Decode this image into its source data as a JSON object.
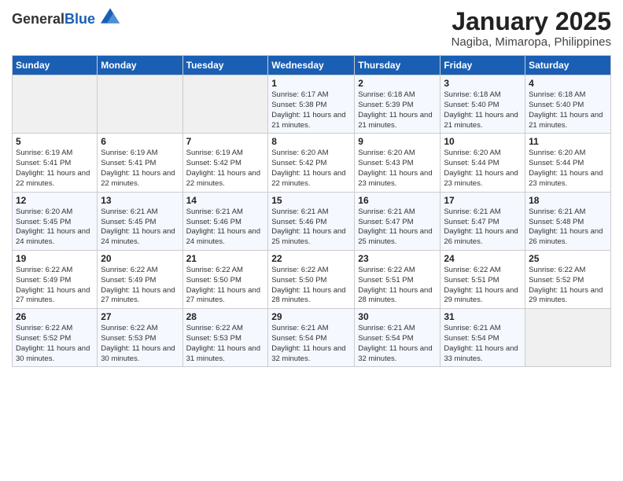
{
  "header": {
    "logo_general": "General",
    "logo_blue": "Blue",
    "title": "January 2025",
    "subtitle": "Nagiba, Mimaropa, Philippines"
  },
  "weekdays": [
    "Sunday",
    "Monday",
    "Tuesday",
    "Wednesday",
    "Thursday",
    "Friday",
    "Saturday"
  ],
  "weeks": [
    [
      {
        "day": "",
        "empty": true
      },
      {
        "day": "",
        "empty": true
      },
      {
        "day": "",
        "empty": true
      },
      {
        "day": "1",
        "sunrise": "6:17 AM",
        "sunset": "5:38 PM",
        "daylight": "11 hours and 21 minutes."
      },
      {
        "day": "2",
        "sunrise": "6:18 AM",
        "sunset": "5:39 PM",
        "daylight": "11 hours and 21 minutes."
      },
      {
        "day": "3",
        "sunrise": "6:18 AM",
        "sunset": "5:40 PM",
        "daylight": "11 hours and 21 minutes."
      },
      {
        "day": "4",
        "sunrise": "6:18 AM",
        "sunset": "5:40 PM",
        "daylight": "11 hours and 21 minutes."
      }
    ],
    [
      {
        "day": "5",
        "sunrise": "6:19 AM",
        "sunset": "5:41 PM",
        "daylight": "11 hours and 22 minutes."
      },
      {
        "day": "6",
        "sunrise": "6:19 AM",
        "sunset": "5:41 PM",
        "daylight": "11 hours and 22 minutes."
      },
      {
        "day": "7",
        "sunrise": "6:19 AM",
        "sunset": "5:42 PM",
        "daylight": "11 hours and 22 minutes."
      },
      {
        "day": "8",
        "sunrise": "6:20 AM",
        "sunset": "5:42 PM",
        "daylight": "11 hours and 22 minutes."
      },
      {
        "day": "9",
        "sunrise": "6:20 AM",
        "sunset": "5:43 PM",
        "daylight": "11 hours and 23 minutes."
      },
      {
        "day": "10",
        "sunrise": "6:20 AM",
        "sunset": "5:44 PM",
        "daylight": "11 hours and 23 minutes."
      },
      {
        "day": "11",
        "sunrise": "6:20 AM",
        "sunset": "5:44 PM",
        "daylight": "11 hours and 23 minutes."
      }
    ],
    [
      {
        "day": "12",
        "sunrise": "6:20 AM",
        "sunset": "5:45 PM",
        "daylight": "11 hours and 24 minutes."
      },
      {
        "day": "13",
        "sunrise": "6:21 AM",
        "sunset": "5:45 PM",
        "daylight": "11 hours and 24 minutes."
      },
      {
        "day": "14",
        "sunrise": "6:21 AM",
        "sunset": "5:46 PM",
        "daylight": "11 hours and 24 minutes."
      },
      {
        "day": "15",
        "sunrise": "6:21 AM",
        "sunset": "5:46 PM",
        "daylight": "11 hours and 25 minutes."
      },
      {
        "day": "16",
        "sunrise": "6:21 AM",
        "sunset": "5:47 PM",
        "daylight": "11 hours and 25 minutes."
      },
      {
        "day": "17",
        "sunrise": "6:21 AM",
        "sunset": "5:47 PM",
        "daylight": "11 hours and 26 minutes."
      },
      {
        "day": "18",
        "sunrise": "6:21 AM",
        "sunset": "5:48 PM",
        "daylight": "11 hours and 26 minutes."
      }
    ],
    [
      {
        "day": "19",
        "sunrise": "6:22 AM",
        "sunset": "5:49 PM",
        "daylight": "11 hours and 27 minutes."
      },
      {
        "day": "20",
        "sunrise": "6:22 AM",
        "sunset": "5:49 PM",
        "daylight": "11 hours and 27 minutes."
      },
      {
        "day": "21",
        "sunrise": "6:22 AM",
        "sunset": "5:50 PM",
        "daylight": "11 hours and 27 minutes."
      },
      {
        "day": "22",
        "sunrise": "6:22 AM",
        "sunset": "5:50 PM",
        "daylight": "11 hours and 28 minutes."
      },
      {
        "day": "23",
        "sunrise": "6:22 AM",
        "sunset": "5:51 PM",
        "daylight": "11 hours and 28 minutes."
      },
      {
        "day": "24",
        "sunrise": "6:22 AM",
        "sunset": "5:51 PM",
        "daylight": "11 hours and 29 minutes."
      },
      {
        "day": "25",
        "sunrise": "6:22 AM",
        "sunset": "5:52 PM",
        "daylight": "11 hours and 29 minutes."
      }
    ],
    [
      {
        "day": "26",
        "sunrise": "6:22 AM",
        "sunset": "5:52 PM",
        "daylight": "11 hours and 30 minutes."
      },
      {
        "day": "27",
        "sunrise": "6:22 AM",
        "sunset": "5:53 PM",
        "daylight": "11 hours and 30 minutes."
      },
      {
        "day": "28",
        "sunrise": "6:22 AM",
        "sunset": "5:53 PM",
        "daylight": "11 hours and 31 minutes."
      },
      {
        "day": "29",
        "sunrise": "6:21 AM",
        "sunset": "5:54 PM",
        "daylight": "11 hours and 32 minutes."
      },
      {
        "day": "30",
        "sunrise": "6:21 AM",
        "sunset": "5:54 PM",
        "daylight": "11 hours and 32 minutes."
      },
      {
        "day": "31",
        "sunrise": "6:21 AM",
        "sunset": "5:54 PM",
        "daylight": "11 hours and 33 minutes."
      },
      {
        "day": "",
        "empty": true
      }
    ]
  ],
  "labels": {
    "sunrise_prefix": "Sunrise: ",
    "sunset_prefix": "Sunset: ",
    "daylight_prefix": "Daylight: "
  }
}
